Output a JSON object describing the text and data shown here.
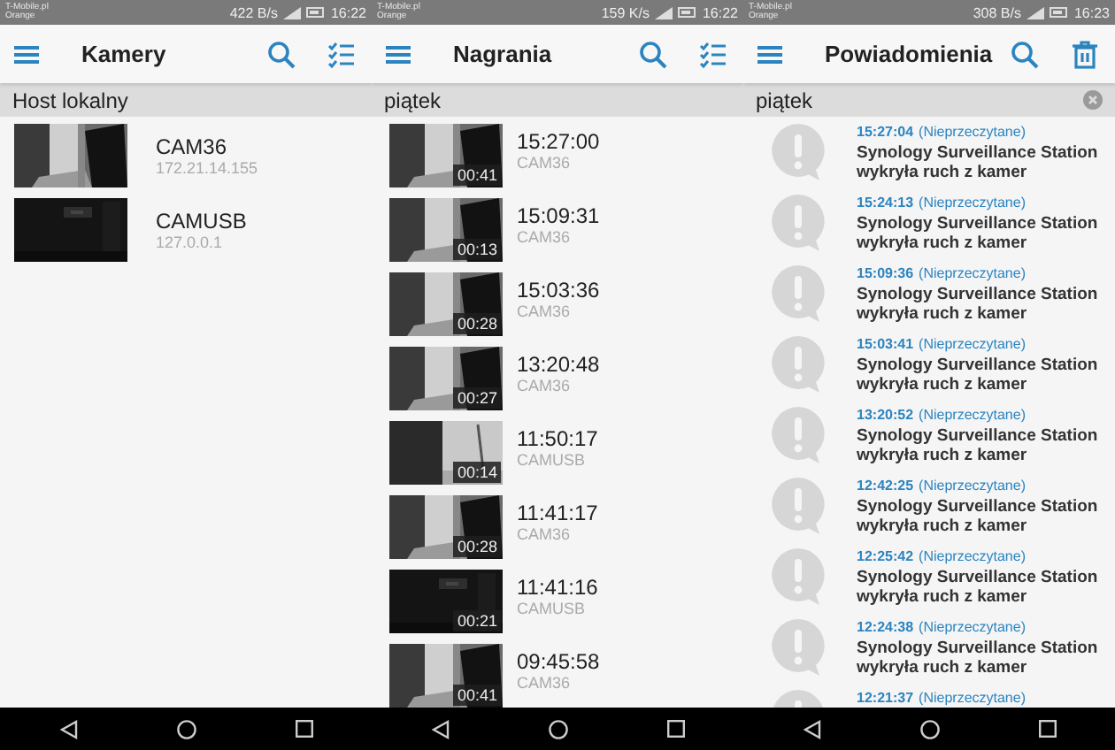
{
  "screens": [
    {
      "kind": "cameras",
      "status_bar": {
        "carrier": "T-Mobile.pl",
        "carrier_2": "Orange",
        "speed": "422 B/s",
        "time": "16:22"
      },
      "title": "Kamery",
      "section": "Host lokalny",
      "items": [
        {
          "name": "CAM36",
          "detail": "172.21.14.155"
        },
        {
          "name": "CAMUSB",
          "detail": "127.0.0.1"
        }
      ]
    },
    {
      "kind": "recordings",
      "status_bar": {
        "carrier": "T-Mobile.pl",
        "carrier_2": "Orange",
        "speed": "159 K/s",
        "time": "16:22"
      },
      "title": "Nagrania",
      "section": "piątek",
      "items": [
        {
          "name": "15:27:00",
          "detail": "CAM36",
          "duration": "00:41"
        },
        {
          "name": "15:09:31",
          "detail": "CAM36",
          "duration": "00:13"
        },
        {
          "name": "15:03:36",
          "detail": "CAM36",
          "duration": "00:28"
        },
        {
          "name": "13:20:48",
          "detail": "CAM36",
          "duration": "00:27"
        },
        {
          "name": "11:50:17",
          "detail": "CAMUSB",
          "duration": "00:14"
        },
        {
          "name": "11:41:17",
          "detail": "CAM36",
          "duration": "00:28"
        },
        {
          "name": "11:41:16",
          "detail": "CAMUSB",
          "duration": "00:21"
        },
        {
          "name": "09:45:58",
          "detail": "CAM36",
          "duration": "00:41"
        }
      ]
    },
    {
      "kind": "notifications",
      "status_bar": {
        "carrier": "T-Mobile.pl",
        "carrier_2": "Orange",
        "speed": "308 B/s",
        "time": "16:23"
      },
      "title": "Powiadomienia",
      "section": "piątek",
      "items": [
        {
          "name": "15:27:04",
          "detail": "(Nieprzeczytane)",
          "message": "Synology Surveillance Station wykryła ruch z kamer"
        },
        {
          "name": "15:24:13",
          "detail": "(Nieprzeczytane)",
          "message": "Synology Surveillance Station wykryła ruch z kamer"
        },
        {
          "name": "15:09:36",
          "detail": "(Nieprzeczytane)",
          "message": "Synology Surveillance Station wykryła ruch z kamer"
        },
        {
          "name": "15:03:41",
          "detail": "(Nieprzeczytane)",
          "message": "Synology Surveillance Station wykryła ruch z kamer"
        },
        {
          "name": "13:20:52",
          "detail": "(Nieprzeczytane)",
          "message": "Synology Surveillance Station wykryła ruch z kamer"
        },
        {
          "name": "12:42:25",
          "detail": "(Nieprzeczytane)",
          "message": "Synology Surveillance Station wykryła ruch z kamer"
        },
        {
          "name": "12:25:42",
          "detail": "(Nieprzeczytane)",
          "message": "Synology Surveillance Station wykryła ruch z kamer"
        },
        {
          "name": "12:24:38",
          "detail": "(Nieprzeczytane)",
          "message": "Synology Surveillance Station wykryła ruch z kamer"
        },
        {
          "name": "12:21:37",
          "detail": "(Nieprzeczytane)"
        }
      ]
    }
  ]
}
